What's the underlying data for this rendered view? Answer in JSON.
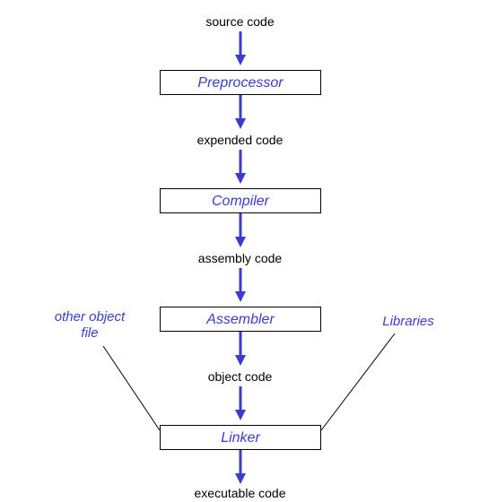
{
  "labels": {
    "source": "source code",
    "expended": "expended code",
    "assembly": "assembly code",
    "object": "object code",
    "executable": "executable code"
  },
  "stages": {
    "preprocessor": "Preprocessor",
    "compiler": "Compiler",
    "assembler": "Assembler",
    "linker": "Linker"
  },
  "side": {
    "other_object_file_l1": "other object",
    "other_object_file_l2": "file",
    "libraries": "Libraries"
  }
}
